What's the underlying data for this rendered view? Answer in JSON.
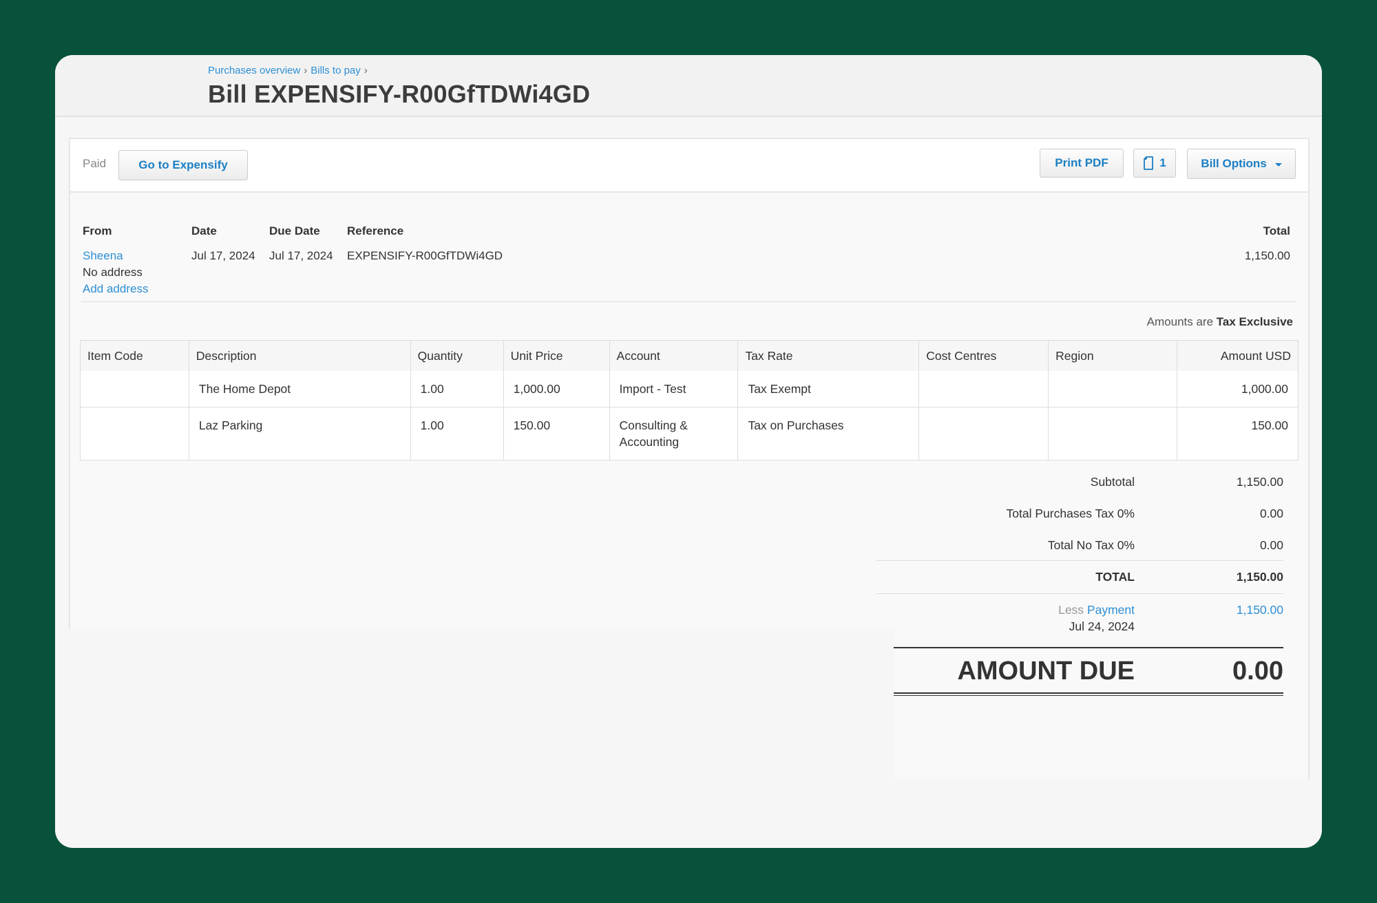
{
  "breadcrumb": {
    "item1": "Purchases overview",
    "item2": "Bills to pay",
    "sep": "›"
  },
  "title": "Bill EXPENSIFY-R00GfTDWi4GD",
  "toolbar": {
    "status": "Paid",
    "goto_label": "Go to Expensify",
    "print_label": "Print PDF",
    "attachments_count": "1",
    "options_label": "Bill Options"
  },
  "details": {
    "from_label": "From",
    "date_label": "Date",
    "due_label": "Due Date",
    "ref_label": "Reference",
    "total_label": "Total",
    "from_name": "Sheena",
    "no_address": "No address",
    "add_address": "Add address",
    "date": "Jul 17, 2024",
    "due_date": "Jul 17, 2024",
    "reference": "EXPENSIFY-R00GfTDWi4GD",
    "total": "1,150.00"
  },
  "tax_note": {
    "prefix": "Amounts are",
    "mode": "Tax Exclusive"
  },
  "table": {
    "headers": [
      "Item Code",
      "Description",
      "Quantity",
      "Unit Price",
      "Account",
      "Tax Rate",
      "Cost Centres",
      "Region",
      "Amount USD"
    ],
    "rows": [
      {
        "item_code": "",
        "description": "The Home Depot",
        "quantity": "1.00",
        "unit_price": "1,000.00",
        "account": "Import - Test",
        "tax_rate": "Tax Exempt",
        "cost_centres": "",
        "region": "",
        "amount": "1,000.00"
      },
      {
        "item_code": "",
        "description": "Laz Parking",
        "quantity": "1.00",
        "unit_price": "150.00",
        "account": "Consulting & Accounting",
        "tax_rate": "Tax on Purchases",
        "cost_centres": "",
        "region": "",
        "amount": "150.00"
      }
    ]
  },
  "totals": {
    "subtotal_label": "Subtotal",
    "subtotal": "1,150.00",
    "purch_tax_label": "Total Purchases Tax 0%",
    "purch_tax": "0.00",
    "no_tax_label": "Total No Tax 0%",
    "no_tax": "0.00",
    "total_label": "TOTAL",
    "total": "1,150.00",
    "less_label": "Less",
    "payment_label": "Payment",
    "payment": "1,150.00",
    "payment_date": "Jul 24, 2024",
    "due_label": "AMOUNT DUE",
    "due": "0.00"
  },
  "colors": {
    "background": "#08513a",
    "link": "#2d8fd5",
    "button_text": "#1b7fc4"
  }
}
